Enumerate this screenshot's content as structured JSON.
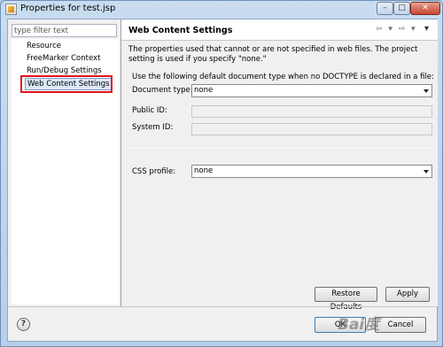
{
  "window": {
    "title": "Properties for test.jsp",
    "minimize": "–",
    "maximize": "□",
    "close": "✕"
  },
  "left": {
    "filter_placeholder": "type filter text",
    "items": [
      {
        "label": "Resource"
      },
      {
        "label": "FreeMarker Context"
      },
      {
        "label": "Run/Debug Settings"
      },
      {
        "label": "Web Content Settings"
      }
    ]
  },
  "page": {
    "title": "Web Content Settings",
    "nav_arrows": "⇦ ▾ ⇨ ▾",
    "view_menu": "▾",
    "description": "The properties used that cannot or are not specified in web files.  The project setting is used if you specify \"none.\"",
    "default_doctype_label": "Use the following default document type when no DOCTYPE is declared in a file:",
    "document_type_label": "Document type:",
    "document_type_value": "none",
    "public_id_label": "Public ID:",
    "system_id_label": "System ID:",
    "css_profile_label": "CSS profile:",
    "css_profile_value": "none",
    "restore_defaults": "Restore Defaults",
    "apply": "Apply"
  },
  "footer": {
    "help": "?",
    "ok": "OK",
    "cancel": "Cancel"
  },
  "watermark": "Bai度"
}
